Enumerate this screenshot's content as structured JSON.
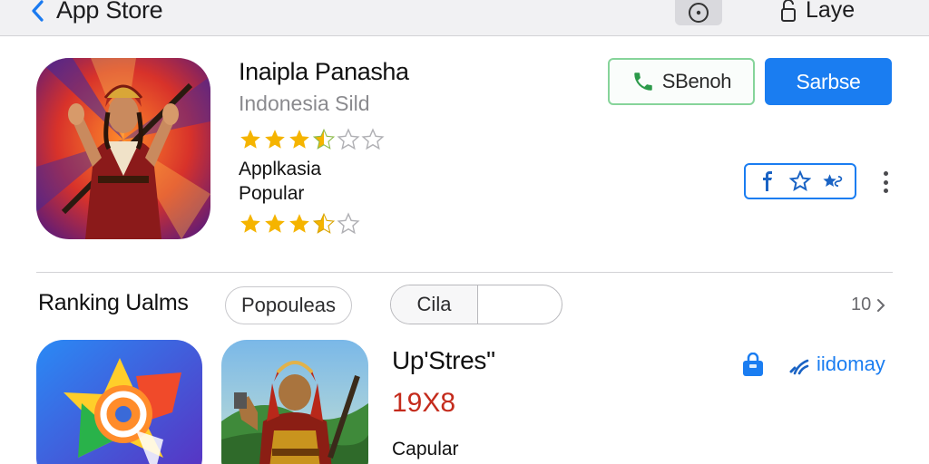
{
  "nav": {
    "back_label": "App Store",
    "layer_label": "Laye"
  },
  "app": {
    "title": "Inaipla Panasha",
    "subtitle": "Indonesia Sild",
    "rating_primary": 3.5,
    "category_line1": "Applkasia",
    "category_line2": "Popular",
    "rating_secondary": 3.5,
    "call_button_label": "SBenoh",
    "primary_button_label": "Sarbse"
  },
  "share": {
    "icons": [
      "facebook-icon",
      "star-outline-icon",
      "stars-icon"
    ]
  },
  "ranking": {
    "title": "Ranking Ualms",
    "chip_label": "Popouleas",
    "segment_label": "Cila",
    "see_all": "10"
  },
  "list_item": {
    "name": "Up'Stres\"",
    "price": "19X8",
    "category": "Capular",
    "link_label": "iidomay"
  },
  "colors": {
    "accent": "#1a7df1",
    "star": "#f5b400",
    "price": "#c42b1c",
    "call_border": "#86d49a",
    "phone": "#2c9a4a"
  }
}
